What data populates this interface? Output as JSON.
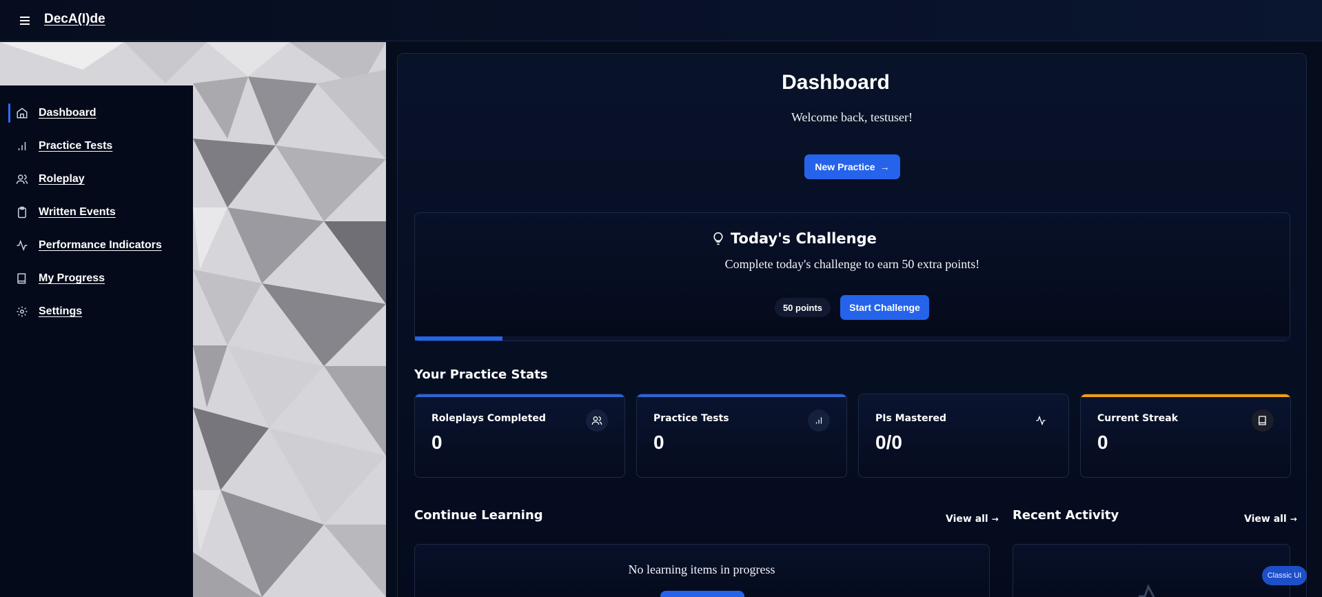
{
  "app": {
    "title": "DecA(I)de"
  },
  "icons": {
    "menu": "menu-icon",
    "home": "home-icon",
    "bar_chart": "bar-chart-icon",
    "users": "users-icon",
    "clipboard": "clipboard-icon",
    "activity": "activity-icon",
    "book": "book-icon",
    "settings": "settings-icon",
    "lightbulb": "lightbulb-icon",
    "arrow_right": "arrow-right-icon"
  },
  "colors": {
    "accent": "#2563eb",
    "streak": "#f59e0b",
    "background": "#050c1c"
  },
  "sidebar": {
    "items": [
      {
        "label": "Dashboard",
        "active": true
      },
      {
        "label": "Practice Tests"
      },
      {
        "label": "Roleplay"
      },
      {
        "label": "Written Events"
      },
      {
        "label": "Performance Indicators"
      },
      {
        "label": "My Progress"
      },
      {
        "label": "Settings"
      }
    ]
  },
  "main": {
    "title": "Dashboard",
    "welcome": "Welcome back, testuser!",
    "new_practice_label": "New Practice"
  },
  "challenge": {
    "title": "Today's Challenge",
    "description": "Complete today's challenge to earn 50 extra points!",
    "points": "50 points",
    "start_label": "Start Challenge",
    "progress": 0.1
  },
  "stats": {
    "heading": "Your Practice Stats",
    "cards": [
      {
        "label": "Roleplays Completed",
        "value": "0",
        "icon": "users-icon"
      },
      {
        "label": "Practice Tests",
        "value": "0",
        "icon": "bar-chart-icon"
      },
      {
        "label": "PIs Mastered",
        "value": "0/0",
        "icon": "activity-icon"
      },
      {
        "label": "Current Streak",
        "value": "0",
        "icon": "book-icon"
      }
    ]
  },
  "learning": {
    "heading": "Continue Learning",
    "view_all": "View all",
    "empty": "No learning items in progress"
  },
  "activity": {
    "heading": "Recent Activity",
    "view_all": "View all"
  },
  "classic_ui_label": "Classic UI"
}
